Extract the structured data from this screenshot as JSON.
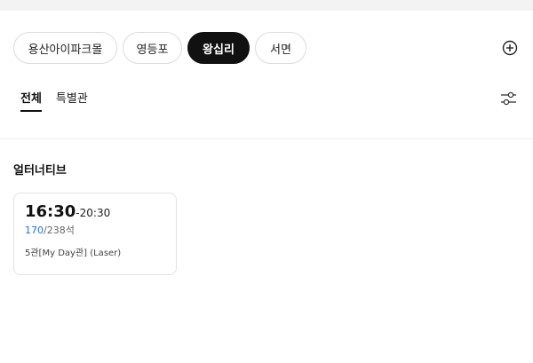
{
  "theaters": [
    "용산아이파크몰",
    "영등포",
    "왕십리",
    "서면"
  ],
  "selected_theater": "왕십리",
  "tabs": [
    "전체",
    "특별관"
  ],
  "active_tab": "전체",
  "section": {
    "title": "얼터너티브"
  },
  "showtime": {
    "start": "16:30",
    "end": "-20:30",
    "seats_remaining": "170",
    "seats_total": "/238석",
    "hall": "5관[My Day관] (Laser)"
  },
  "icons": {
    "add": "plus-circle-icon",
    "filter": "filter-sliders-icon"
  },
  "colors": {
    "selected_chip": "#111111",
    "seats_remaining": "#2a6fdb"
  }
}
